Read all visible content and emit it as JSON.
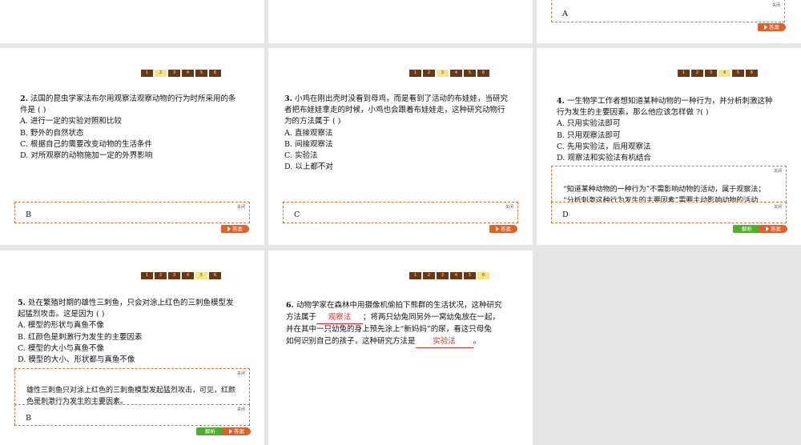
{
  "common": {
    "close_label": "关闭",
    "answer_btn": "答案",
    "explain_btn": "解析"
  },
  "pager_pages": [
    "1",
    "2",
    "3",
    "4",
    "5",
    "6"
  ],
  "top_right": {
    "answer": "A"
  },
  "q2": {
    "number": "2",
    "lines": [
      "法国的昆虫学家法布尔用观察法观察动物的行为时所采用的条",
      "件是 ( )"
    ],
    "options": [
      "A. 进行一定的实验对照和比较",
      "B. 野外的自然状态",
      "C. 根据自己的需要改变动物的生活条件",
      "D. 对所观察的动物施加一定的外界影响"
    ],
    "answer": "B"
  },
  "q3": {
    "number": "3",
    "lines": [
      "小鸡在刚出壳时没看到母鸡，而是看到了活动的布娃娃，当研究",
      "者把布娃娃拿走的时候，小鸡也会跟着布娃娃走，这种研究动物行",
      "为的方法属于 ( )"
    ],
    "options": [
      "A. 直接观察法",
      "B. 间接观察法",
      "C. 实验法",
      "D. 以上都不对"
    ],
    "answer": "C"
  },
  "q4": {
    "number": "4",
    "lines": [
      "一生物学工作者想知道某种动物的一种行为，并分析刺激这种",
      "行为发生的主要因素，那么他应该怎样做 ?( )"
    ],
    "options": [
      "A. 只用实验法即可",
      "B. 只用观察法即可",
      "C. 先用实验法，后用观察法",
      "D. 观察法和实验法有机结合"
    ],
    "explanation": [
      "“知道某种动物的一种行为”不需影响动物的活动，属于观察法；",
      "“分析刺激这种行为发生的主要因素”需要主动影响动物的活动"
    ],
    "answer": "D"
  },
  "q5": {
    "number": "5",
    "lines": [
      "处在繁殖时期的雄性三刺鱼，只会对涂上红色的三刺鱼模型发",
      "起猛烈攻击。这是因为 ( )"
    ],
    "options": [
      "A. 模型的形状与真鱼不像",
      "B. 红颜色是刺激行为发生的主要因素",
      "C. 模型的大小与真鱼不像",
      "D. 模型的大小、形状都与真鱼不像"
    ],
    "explanation": [
      "雄性三刺鱼只对涂上红色的三刺鱼模型发起猛烈攻击，可见，红颜",
      "色是刺激行为发生的主要因素。"
    ],
    "answer": "B"
  },
  "q6": {
    "number": "6",
    "line1": "动物学家在森林中用摄像机偷拍下熊群的生活状况，这种研究",
    "line2_pre": "方法属于",
    "fill1": "观察法",
    "line2_post": "；将两只幼兔同另外一窝幼兔放在一起，",
    "line3": "并在其中一只幼兔的身上预先涂上“新妈妈”的尿，看这只母兔",
    "line4_pre": "如何识别自己的孩子，这种研究方法是",
    "fill2": "实验法",
    "line4_post": "。"
  }
}
